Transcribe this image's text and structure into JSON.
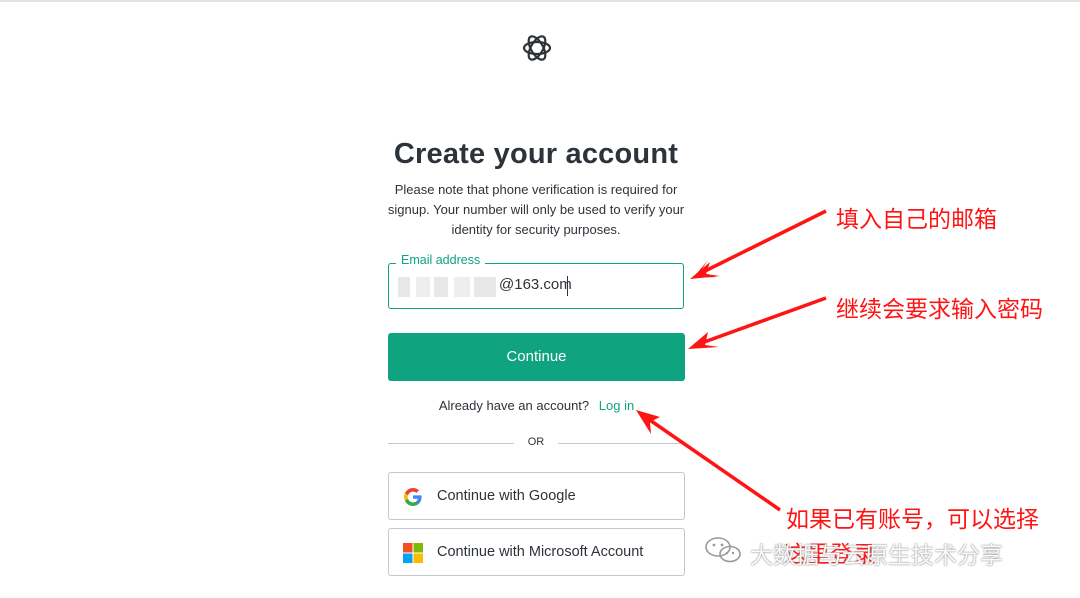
{
  "logo": {
    "icon": "openai-logo-icon"
  },
  "form": {
    "title": "Create your account",
    "subtitle": "Please note that phone verification is required for signup. Your number will only be used to verify your identity for security purposes.",
    "email_label": "Email address",
    "email_value": "@163.com",
    "continue_label": "Continue",
    "already_text": "Already have an account?",
    "login_label": "Log in",
    "or_text": "OR",
    "google_label": "Continue with Google",
    "microsoft_label": "Continue with Microsoft Account"
  },
  "annotations": {
    "email_note": "填入自己的邮箱",
    "continue_note": "继续会要求输入密码",
    "login_note_line1": "如果已有账号，可以选择",
    "login_note_line2": "这里登录"
  },
  "watermark": {
    "text": "大数据与云原生技术分享",
    "icon": "wechat-icon"
  },
  "colors": {
    "accent": "#10a37f",
    "annotation": "#ff1414",
    "text": "#2d333a"
  }
}
